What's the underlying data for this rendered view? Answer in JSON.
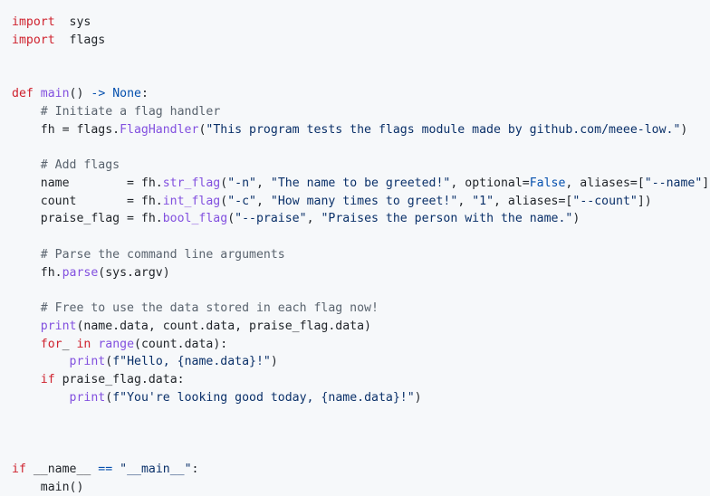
{
  "language": "python",
  "theme": {
    "background": "#f6f8fa",
    "text": "#1f2328",
    "keyword": "#cf222e",
    "function": "#8250df",
    "comment": "#59636e",
    "string": "#0a3069",
    "constant": "#0550ae"
  },
  "lines": [
    [
      [
        "kw",
        "import"
      ],
      [
        "",
        "  sys"
      ]
    ],
    [
      [
        "kw",
        "import"
      ],
      [
        "",
        "  flags"
      ]
    ],
    [],
    [],
    [
      [
        "kw",
        "def"
      ],
      [
        "",
        " "
      ],
      [
        "fn",
        "main"
      ],
      [
        "",
        "() "
      ],
      [
        "nm",
        "->"
      ],
      [
        "",
        " "
      ],
      [
        "nm",
        "None"
      ],
      [
        "",
        ":"
      ]
    ],
    [
      [
        "",
        "    "
      ],
      [
        "cm",
        "# Initiate a flag handler"
      ]
    ],
    [
      [
        "",
        "    fh = flags."
      ],
      [
        "fn",
        "FlagHandler"
      ],
      [
        "",
        "("
      ],
      [
        "st",
        "\"This program tests the flags module made by github.com/meee-low.\""
      ],
      [
        "",
        ")"
      ]
    ],
    [],
    [
      [
        "",
        "    "
      ],
      [
        "cm",
        "# Add flags"
      ]
    ],
    [
      [
        "",
        "    name        = fh."
      ],
      [
        "fn",
        "str_flag"
      ],
      [
        "",
        "("
      ],
      [
        "st",
        "\"-n\""
      ],
      [
        "",
        ", "
      ],
      [
        "st",
        "\"The name to be greeted!\""
      ],
      [
        "",
        ", optional="
      ],
      [
        "nm",
        "False"
      ],
      [
        "",
        ", aliases=["
      ],
      [
        "st",
        "\"--name\""
      ],
      [
        "",
        "])"
      ]
    ],
    [
      [
        "",
        "    count       = fh."
      ],
      [
        "fn",
        "int_flag"
      ],
      [
        "",
        "("
      ],
      [
        "st",
        "\"-c\""
      ],
      [
        "",
        ", "
      ],
      [
        "st",
        "\"How many times to greet!\""
      ],
      [
        "",
        ", "
      ],
      [
        "st",
        "\"1\""
      ],
      [
        "",
        ", aliases=["
      ],
      [
        "st",
        "\"--count\""
      ],
      [
        "",
        "])"
      ]
    ],
    [
      [
        "",
        "    praise_flag = fh."
      ],
      [
        "fn",
        "bool_flag"
      ],
      [
        "",
        "("
      ],
      [
        "st",
        "\"--praise\""
      ],
      [
        "",
        ", "
      ],
      [
        "st",
        "\"Praises the person with the name.\""
      ],
      [
        "",
        ")"
      ]
    ],
    [],
    [
      [
        "",
        "    "
      ],
      [
        "cm",
        "# Parse the command line arguments"
      ]
    ],
    [
      [
        "",
        "    fh."
      ],
      [
        "fn",
        "parse"
      ],
      [
        "",
        "(sys.argv)"
      ]
    ],
    [],
    [
      [
        "",
        "    "
      ],
      [
        "cm",
        "# Free to use the data stored in each flag now!"
      ]
    ],
    [
      [
        "",
        "    "
      ],
      [
        "fn",
        "print"
      ],
      [
        "",
        "(name.data, count.data, praise_flag.data)"
      ]
    ],
    [
      [
        "",
        "    "
      ],
      [
        "kw",
        "for"
      ],
      [
        "",
        "",
        " "
      ],
      [
        "",
        "_ "
      ],
      [
        "kw",
        "in"
      ],
      [
        "",
        " "
      ],
      [
        "fn",
        "range"
      ],
      [
        "",
        "(count.data):"
      ]
    ],
    [
      [
        "",
        "        "
      ],
      [
        "fn",
        "print"
      ],
      [
        "",
        "("
      ],
      [
        "st",
        "f\"Hello, {name.data}!\""
      ],
      [
        "",
        ")"
      ]
    ],
    [
      [
        "",
        "    "
      ],
      [
        "kw",
        "if"
      ],
      [
        "",
        " praise_flag.data:"
      ]
    ],
    [
      [
        "",
        "        "
      ],
      [
        "fn",
        "print"
      ],
      [
        "",
        "("
      ],
      [
        "st",
        "f\"You're looking good today, {name.data}!\""
      ],
      [
        "",
        ")"
      ]
    ],
    [],
    [],
    [],
    [
      [
        "kw",
        "if"
      ],
      [
        "",
        " __name__ "
      ],
      [
        "nm",
        "=="
      ],
      [
        "",
        " "
      ],
      [
        "st",
        "\"__main__\""
      ],
      [
        "",
        ":"
      ]
    ],
    [
      [
        "",
        "    main()"
      ]
    ]
  ]
}
